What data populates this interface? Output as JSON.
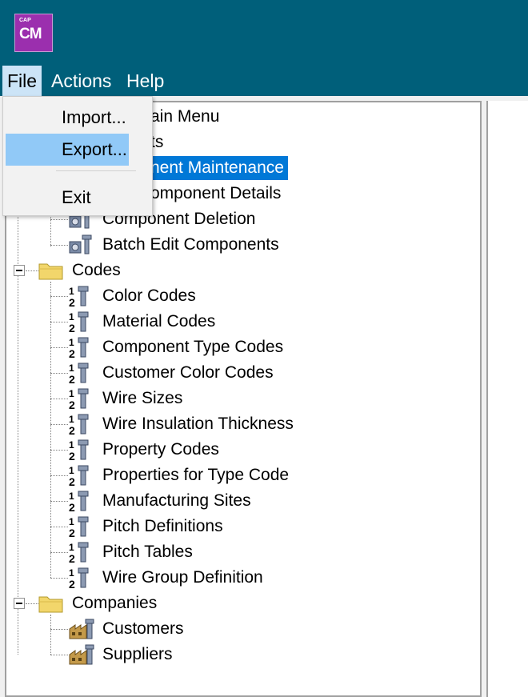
{
  "app": {
    "logo_small": "CAP",
    "logo_large": "CM"
  },
  "menubar": {
    "file": "File",
    "actions": "Actions",
    "help": "Help"
  },
  "file_menu": {
    "import": "Import...",
    "export": "Export...",
    "exit": "Exit"
  },
  "tree": {
    "hidden_rows": {
      "main_menu": "Main Menu",
      "components": "Components",
      "component_maintenance": "Component Maintenance",
      "component_details": "Component Details"
    },
    "component_deletion": "Component Deletion",
    "batch_edit": "Batch Edit Components",
    "codes_folder": "Codes",
    "codes": [
      "Color Codes",
      "Material Codes",
      "Component Type Codes",
      "Customer Color Codes",
      "Wire Sizes",
      "Wire Insulation Thickness",
      "Property Codes",
      "Properties for Type Code",
      "Manufacturing Sites",
      "Pitch Definitions",
      "Pitch Tables",
      "Wire Group Definition"
    ],
    "companies_folder": "Companies",
    "companies": [
      "Customers",
      "Suppliers"
    ]
  },
  "icons": {
    "folder": "folder-icon",
    "code": "code-definition-icon",
    "gear": "gear-tool-icon",
    "factory": "factory-icon"
  },
  "colors": {
    "titlebar": "#005f7a",
    "selection": "#0078d7",
    "menu_highlight": "#91c9f7"
  }
}
